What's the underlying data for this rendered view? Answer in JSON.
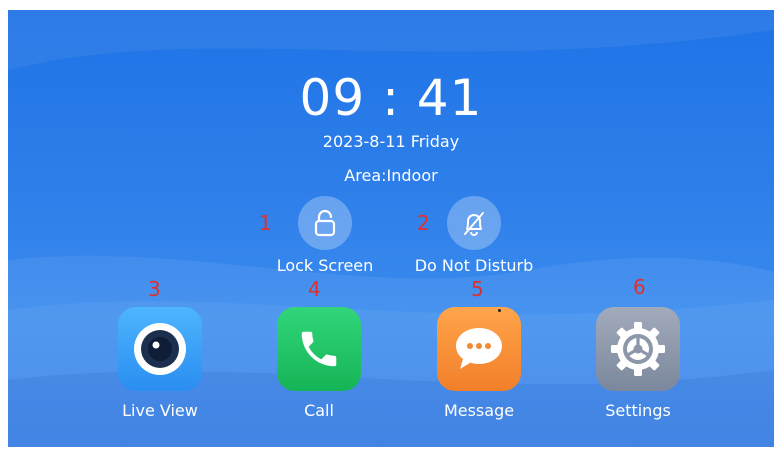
{
  "clock": {
    "time": "09 : 41",
    "date": "2023-8-11 Friday",
    "area": "Area:Indoor"
  },
  "quick_actions": [
    {
      "label": "Lock Screen",
      "icon": "lock-icon",
      "marker": "1"
    },
    {
      "label": "Do Not Disturb",
      "icon": "bell-off-icon",
      "marker": "2"
    }
  ],
  "apps": [
    {
      "label": "Live View",
      "icon": "camera-icon",
      "marker": "3",
      "color": "#3aa3f5"
    },
    {
      "label": "Call",
      "icon": "phone-icon",
      "marker": "4",
      "color": "#21c766"
    },
    {
      "label": "Message",
      "icon": "chat-icon",
      "marker": "5",
      "color": "#f7913a"
    },
    {
      "label": "Settings",
      "icon": "gear-icon",
      "marker": "6",
      "color": "#8c97aa"
    }
  ],
  "colors": {
    "background": "#2f80ea",
    "marker": "#e0302e"
  }
}
